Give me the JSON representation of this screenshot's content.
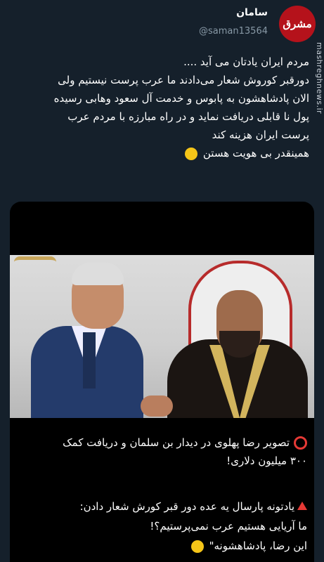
{
  "user": {
    "name": "سامان",
    "handle": "@saman13564",
    "avatar_text": "مشرق"
  },
  "watermark": "mashreghnews.ir",
  "tweet": {
    "lines": [
      "مردم ایران یادتان می آید ....",
      "دورقبر کوروش شعار می‌دادند ما عرب پرست نیستیم ولی",
      "الان پادشاهشون به پابوس و خدمت آل سعود وهابی رسیده",
      "پول نا قابلی دریافت نماید و  در راه مبارزه با مردم عرب",
      "پرست ایران هزینه کند",
      "همینقدر بی هویت هستن"
    ],
    "emoji": "rolling-on-floor-laughing-emoji"
  },
  "media": {
    "caption1": [
      "تصویر رضا پهلوی در دیدار بن سلمان و دریافت کمک",
      "۳۰۰ میلیون دلاری!"
    ],
    "caption2": [
      "یادتونه پارسال یه عده دور قبر کورش شعار دادن:",
      "ما آریایی هستیم عرب نمی‌پرستیم؟!",
      "این رضا، پادشاهشونه\""
    ]
  },
  "colors": {
    "background": "#15202b",
    "secondary_text": "#8899a6",
    "accent_red": "#e53935"
  }
}
